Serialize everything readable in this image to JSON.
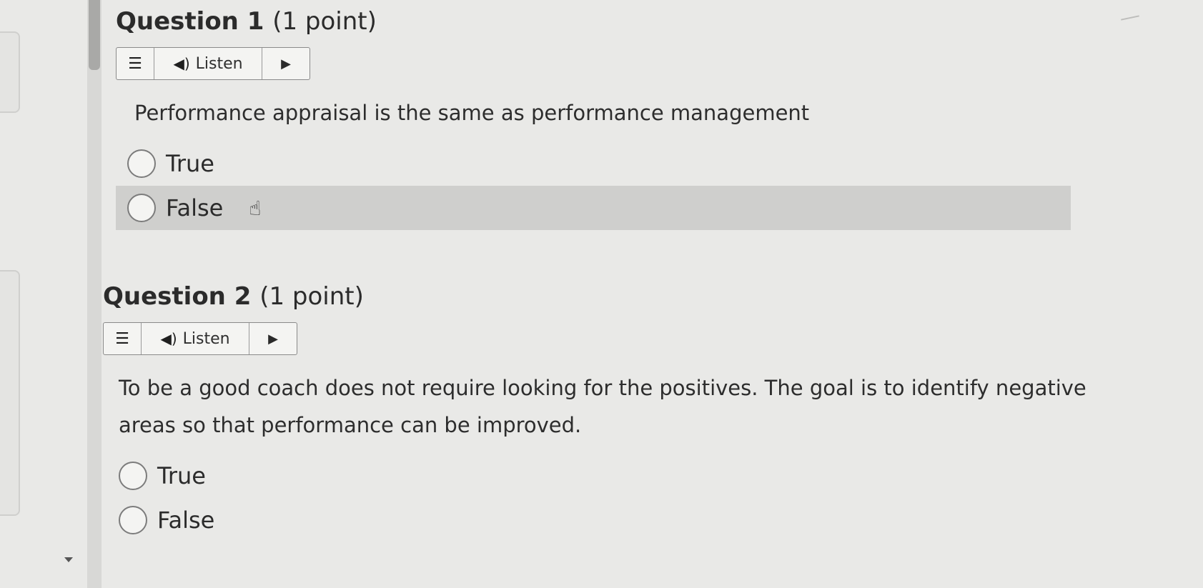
{
  "questions": [
    {
      "title": "Question 1",
      "points": "(1 point)",
      "listen": {
        "menu_icon": "menu-icon",
        "speaker_icon": "speaker-icon",
        "label": "Listen",
        "play_icon": "play-icon"
      },
      "text": "Performance appraisal is the same as performance management",
      "options": [
        {
          "label": "True",
          "selected": false
        },
        {
          "label": "False",
          "selected": false,
          "hovered": true
        }
      ]
    },
    {
      "title": "Question 2",
      "points": "(1 point)",
      "listen": {
        "menu_icon": "menu-icon",
        "speaker_icon": "speaker-icon",
        "label": "Listen",
        "play_icon": "play-icon"
      },
      "text": "To be a good coach does not require looking for the positives. The goal is to identify negative areas so that performance can be improved.",
      "options": [
        {
          "label": "True",
          "selected": false
        },
        {
          "label": "False",
          "selected": false
        }
      ]
    }
  ],
  "colors": {
    "background": "#e9e9e7",
    "hover_row": "#cfcfcd",
    "text": "#2b2b2b"
  }
}
